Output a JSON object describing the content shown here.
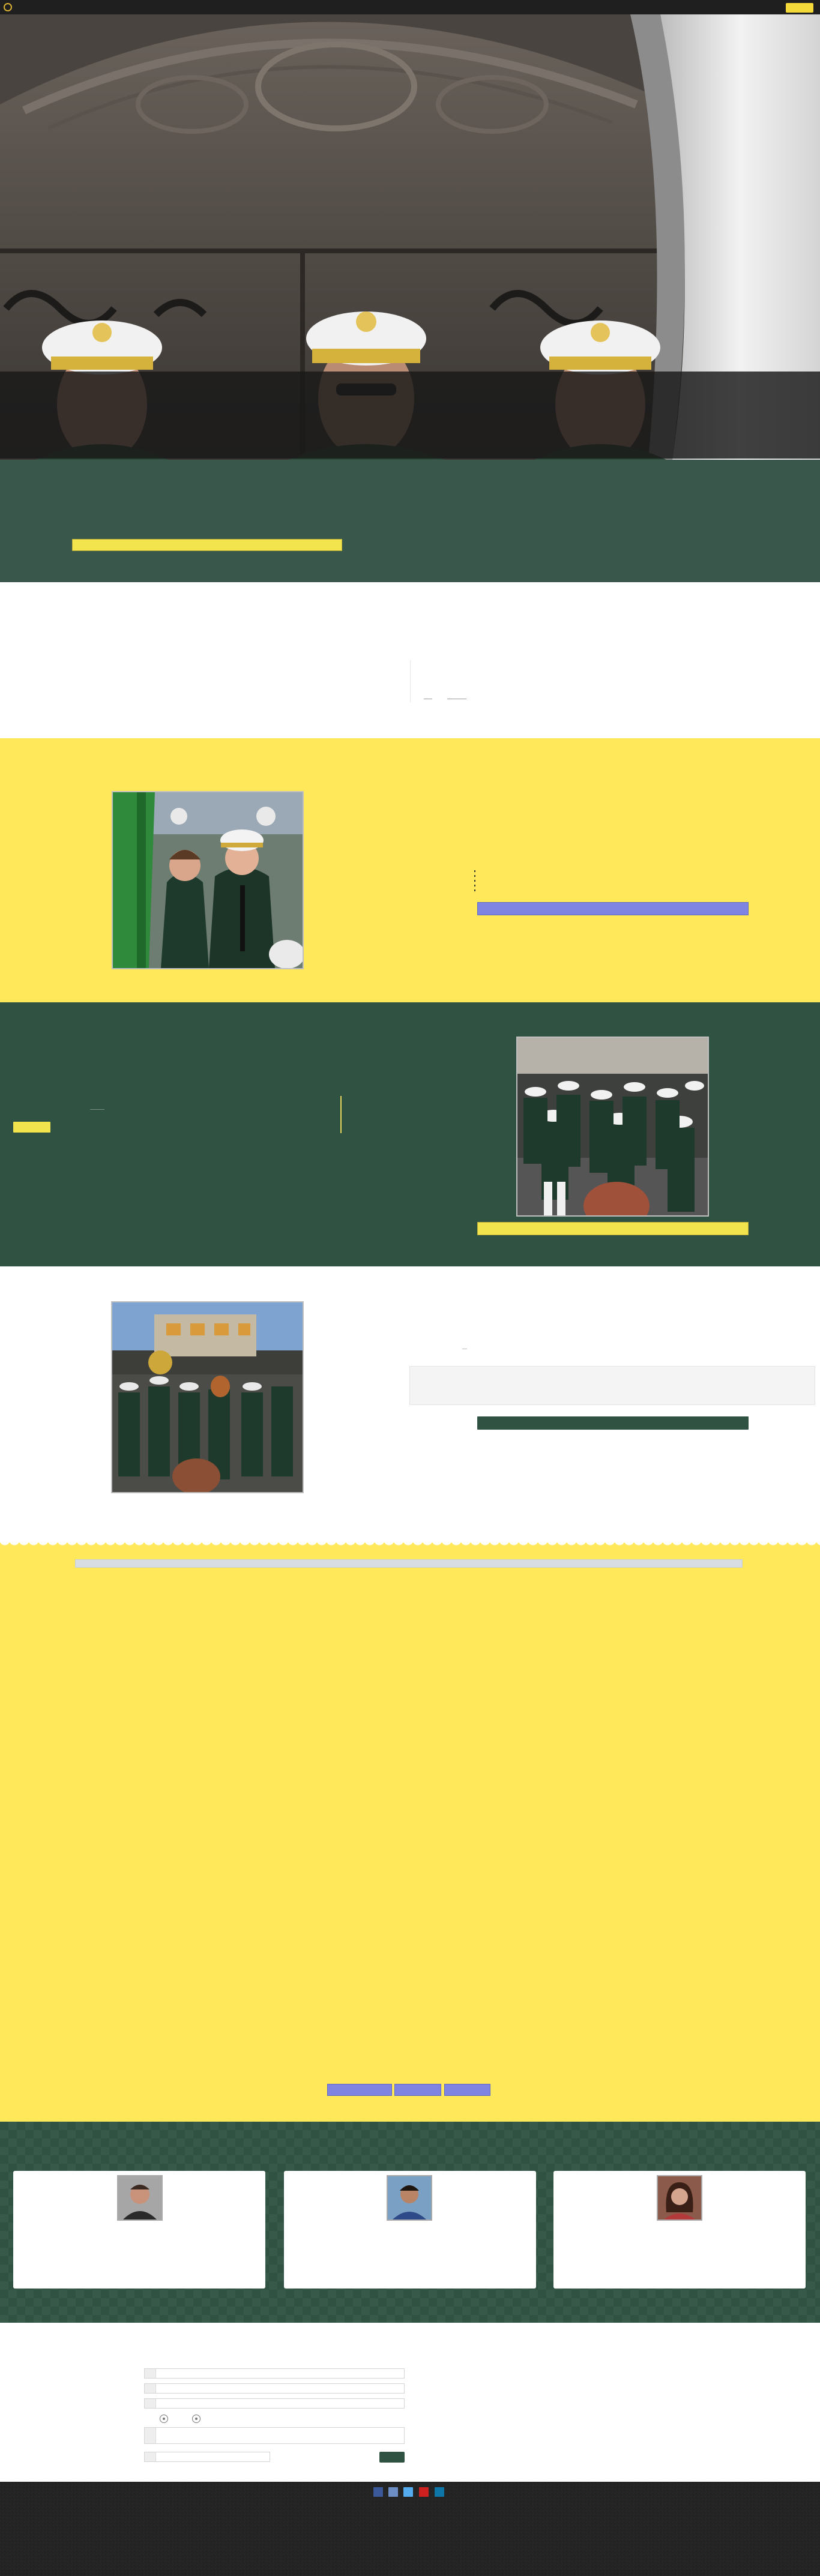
{
  "colors": {
    "top_bar": "#1f1f1f",
    "green": "#2f5243",
    "intro_green": "#39574a",
    "yellow": "#ffe95a",
    "accent_yellow": "#f2e44d",
    "periwinkle": "#7f84e3",
    "footer": "#232323"
  },
  "header": {
    "logo_icon": "band-crest-icon",
    "menu_button_icon": "menu-button"
  },
  "hero": {
    "image": "band-members-in-white-caps-photo"
  },
  "sections": {
    "yellow": {
      "image": "students-with-flag-photo"
    },
    "green": {
      "image": "marching-band-parade-photo"
    },
    "white": {
      "image": "band-marching-street-photo"
    }
  },
  "staff": {
    "cards": [
      {
        "avatar": "man-portrait-photo"
      },
      {
        "avatar": "young-man-portrait-photo"
      },
      {
        "avatar": "woman-portrait-photo"
      }
    ]
  },
  "footer": {
    "social_icons": [
      "facebook-icon",
      "twitter-icon",
      "twitter-bird-icon",
      "youtube-icon",
      "linkedin-icon"
    ],
    "social_colors": [
      "#3b5998",
      "#6c8ec5",
      "#55acee",
      "#cd201f",
      "#0e76a8"
    ]
  }
}
